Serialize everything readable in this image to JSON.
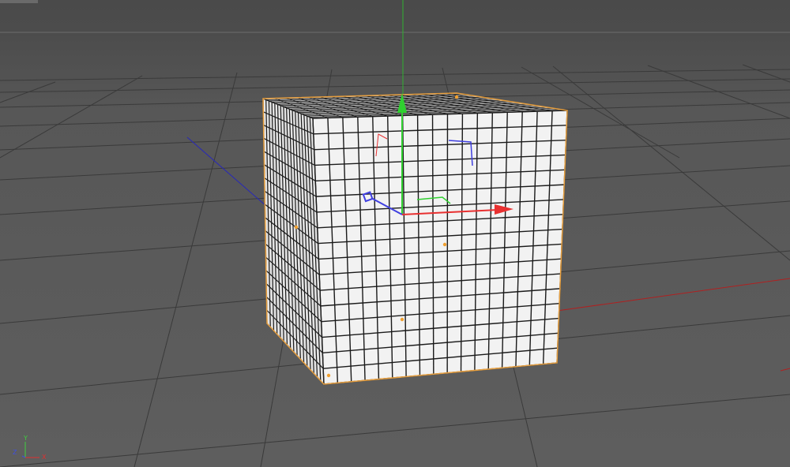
{
  "viewport": {
    "background_color": "#5a5a5a",
    "grid_color": "#3a3a3a",
    "horizon_line_color": "#6e6e6e"
  },
  "object": {
    "type": "cube",
    "subdivisions_front": 17,
    "subdivisions_side": 17,
    "face_color": "#f2f2f2",
    "wire_color": "#1a1a1a",
    "selection_outline_color": "#e8a040",
    "point_color": "#f0a030"
  },
  "gizmo": {
    "x_color": "#e83030",
    "y_color": "#30d030",
    "z_color": "#4040e0"
  },
  "world_axes": {
    "x_color": "#b02020",
    "z_color": "#2828b8"
  },
  "axis_triad": {
    "x_label": "X",
    "y_label": "Y",
    "z_label": "Z",
    "x_color": "#e03030",
    "y_color": "#40d040",
    "z_color": "#4050e0"
  }
}
